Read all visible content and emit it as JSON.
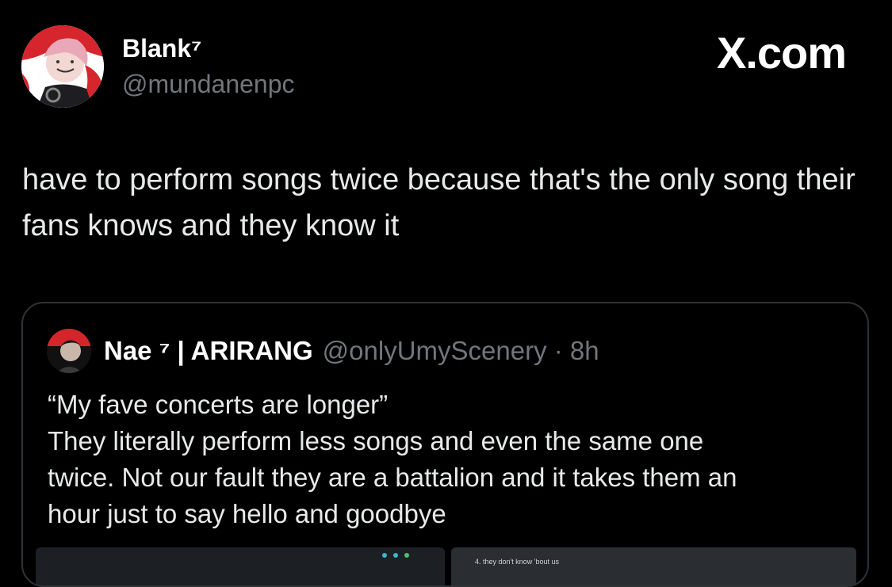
{
  "author": {
    "display_name": "Blank⁷",
    "handle": "@mundanenpc",
    "avatar_icon": "profile-avatar"
  },
  "brand": {
    "label": "X.com"
  },
  "tweet": {
    "text": "have to perform songs twice because that's the only song their fans knows and they know it"
  },
  "quoted": {
    "name": "Nae ⁷ | ARIRANG",
    "handle_time": "@onlyUmyScenery · 8h",
    "avatar_icon": "profile-avatar",
    "lines": [
      "“My fave concerts are longer”",
      "They literally perform less songs and even the same one",
      "twice. Not our fault they are a battalion and it takes them an",
      "hour just to say hello and goodbye"
    ],
    "media_caption": "4. they don't know 'bout us"
  },
  "colors": {
    "background": "#000000",
    "primary_text": "#e7e9ea",
    "secondary_text": "#71767b",
    "border": "#2f3336",
    "avatar_accent": "#e0282e"
  }
}
